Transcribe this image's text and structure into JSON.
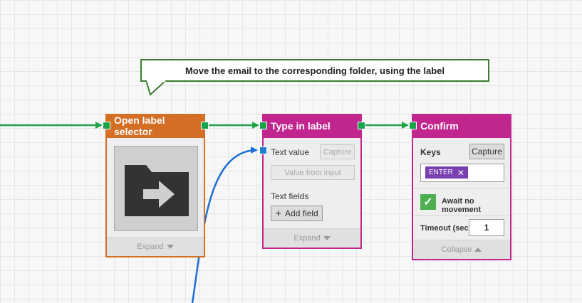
{
  "annotation": {
    "text": "Move the email to the corresponding folder, using the label"
  },
  "colors": {
    "orange": "#d46e25",
    "magenta": "#c1268f",
    "green_port": "#17a34a",
    "blue_port": "#1d7ed6",
    "flow_green": "#21a34a",
    "flow_blue": "#1d6fd6"
  },
  "nodes": {
    "open_label_selector": {
      "title": "Open label selector",
      "image_icon": "folder-move-icon",
      "footer_label": "Expand"
    },
    "type_in_label": {
      "title": "Type in label",
      "text_value_label": "Text value",
      "capture_label": "Capture",
      "value_from_input_label": "Value from input",
      "text_fields_label": "Text fields",
      "add_field_label": "Add field",
      "footer_label": "Expand"
    },
    "confirm": {
      "title": "Confirm",
      "keys_label": "Keys",
      "capture_label": "Capture",
      "key_chip": "ENTER",
      "await_label": "Await no movement",
      "await_checked": true,
      "timeout_label": "Timeout (sec)",
      "timeout_value": "1",
      "footer_label": "Collapse"
    }
  }
}
